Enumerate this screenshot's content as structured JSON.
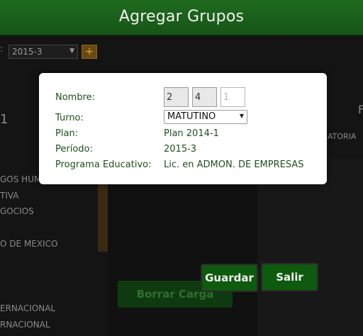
{
  "header": {
    "title": "Agregar Grupos"
  },
  "background": {
    "period_select": "2015-3",
    "plus_symbol": "+",
    "count": "1",
    "right_letter": "F",
    "right_header": "ATORIA",
    "rows": [
      "GOS HUM",
      "TIVA",
      "GOCIOS",
      "O DE MEXICO",
      "ERNACIONAL",
      "RNACIONAL"
    ],
    "borrar_button": "Borrar Carga"
  },
  "modal": {
    "nombre_label": "Nombre:",
    "nombre_parts": [
      "2",
      "4",
      "1"
    ],
    "turno_label": "Turno:",
    "turno_value": "MATUTINO",
    "plan_label": "Plan:",
    "plan_value": "Plan 2014-1",
    "periodo_label": "Período:",
    "periodo_value": "2015-3",
    "programa_label": "Programa Educativo:",
    "programa_value": "Lic. en ADMON. DE EMPRESAS"
  },
  "actions": {
    "guardar": "Guardar",
    "salir": "Salir"
  }
}
